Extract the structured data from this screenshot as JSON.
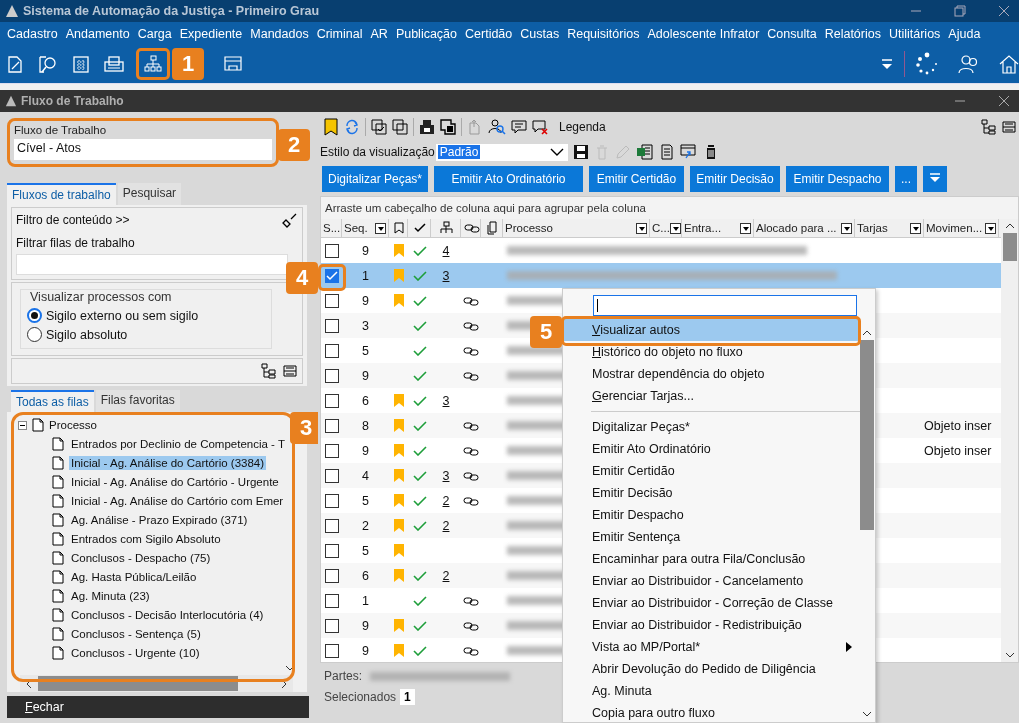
{
  "window": {
    "title": "Sistema de Automação da Justiça - Primeiro Grau"
  },
  "menu": [
    "Cadastro",
    "Andamento",
    "Carga",
    "Expediente",
    "Mandados",
    "Criminal",
    "AR",
    "Publicação",
    "Certidão",
    "Custas",
    "Requisitórios",
    "Adolescente Infrator",
    "Consulta",
    "Relatórios",
    "Utilitários",
    "Ajuda"
  ],
  "subwindow": {
    "title": "Fluxo de Trabalho"
  },
  "callouts": [
    "1",
    "2",
    "3",
    "4",
    "5"
  ],
  "left": {
    "workflow_field": {
      "label": "Fluxo de Trabalho",
      "value": "Cível - Atos"
    },
    "tabs": [
      {
        "label": "Fluxos de trabalho",
        "selected": true
      },
      {
        "label": "Pesquisar",
        "selected": false
      }
    ],
    "filter": {
      "title": "Filtro de conteúdo >>",
      "field_label": "Filtrar filas de trabalho"
    },
    "visibility": {
      "legend": "Visualizar processos com",
      "options": [
        {
          "label": "Sigilo externo ou sem sigilo",
          "selected": true
        },
        {
          "label": "Sigilo absoluto",
          "selected": false
        }
      ]
    },
    "queue_tabs": [
      {
        "label": "Todas as filas",
        "selected": true
      },
      {
        "label": "Filas favoritas",
        "selected": false
      }
    ],
    "tree": {
      "label": "Processo",
      "expanded": true,
      "children": [
        {
          "label": "Entrados por Declinio de Competencia - T",
          "selected": false
        },
        {
          "label": "Inicial - Ag. Análise do Cartório (3384)",
          "selected": true
        },
        {
          "label": "Inicial - Ag. Análise do Cartório - Urgente",
          "selected": false
        },
        {
          "label": "Inicial - Ag. Análise do Cartório com Emer",
          "selected": false
        },
        {
          "label": "Ag. Análise - Prazo Expirado (371)",
          "selected": false
        },
        {
          "label": "Entrados com Sigilo Absoluto",
          "selected": false
        },
        {
          "label": "Conclusos - Despacho (75)",
          "selected": false
        },
        {
          "label": "Ag. Hasta Pública/Leilão",
          "selected": false
        },
        {
          "label": "Ag. Minuta (23)",
          "selected": false
        },
        {
          "label": "Conclusos - Decisão Interlocutória (4)",
          "selected": false
        },
        {
          "label": "Conclusos - Sentença (5)",
          "selected": false
        },
        {
          "label": "Conclusos - Urgente (10)",
          "selected": false
        }
      ]
    },
    "close_button": "Fechar"
  },
  "right": {
    "legend": "Legenda",
    "view_style": {
      "label": "Estilo da visualização",
      "value": "Padrão"
    },
    "action_buttons": [
      "Digitalizar Peças*",
      "Emitir Ato Ordinatório",
      "Emitir Certidão",
      "Emitir Decisão",
      "Emitir Despacho",
      "..."
    ],
    "group_hint": "Arraste um cabeçalho de coluna aqui para agrupar pela coluna",
    "columns": [
      "S...",
      "Seq.",
      "Processo",
      "C...",
      "Entra...",
      "Alocado para ...",
      "Tarjas",
      "Movimen..."
    ],
    "rows": [
      {
        "seq": "9",
        "bookmark": true,
        "done": true,
        "count": "4",
        "linked": false,
        "checked": false,
        "selected": false
      },
      {
        "seq": "1",
        "bookmark": true,
        "done": true,
        "count": "3",
        "linked": false,
        "checked": true,
        "selected": true
      },
      {
        "seq": "9",
        "bookmark": true,
        "done": true,
        "linked": true,
        "checked": false,
        "selected": false
      },
      {
        "seq": "3",
        "bookmark": false,
        "done": true,
        "linked": true,
        "checked": false,
        "selected": false
      },
      {
        "seq": "5",
        "bookmark": false,
        "done": true,
        "linked": true,
        "checked": false,
        "selected": false
      },
      {
        "seq": "9",
        "bookmark": false,
        "done": true,
        "linked": true,
        "checked": false,
        "selected": false
      },
      {
        "seq": "6",
        "bookmark": true,
        "done": true,
        "count": "3",
        "linked": false,
        "checked": false,
        "selected": false
      },
      {
        "seq": "8",
        "bookmark": true,
        "done": true,
        "linked": true,
        "movement": "Objeto inser",
        "checked": false,
        "selected": false
      },
      {
        "seq": "9",
        "bookmark": true,
        "done": true,
        "linked": true,
        "movement": "Objeto inser",
        "checked": false,
        "selected": false
      },
      {
        "seq": "4",
        "bookmark": true,
        "done": true,
        "count": "3",
        "linked": true,
        "checked": false,
        "selected": false
      },
      {
        "seq": "5",
        "bookmark": true,
        "done": true,
        "count": "2",
        "linked": true,
        "checked": false,
        "selected": false
      },
      {
        "seq": "2",
        "bookmark": true,
        "done": true,
        "count": "2",
        "linked": false,
        "checked": false,
        "selected": false
      },
      {
        "seq": "5",
        "bookmark": true,
        "done": false,
        "linked": false,
        "checked": false,
        "selected": false
      },
      {
        "seq": "6",
        "bookmark": true,
        "done": true,
        "count": "2",
        "linked": false,
        "checked": false,
        "selected": false
      },
      {
        "seq": "1",
        "bookmark": false,
        "done": true,
        "linked": true,
        "checked": false,
        "selected": false
      },
      {
        "seq": "9",
        "bookmark": true,
        "done": true,
        "linked": true,
        "checked": false,
        "selected": false
      },
      {
        "seq": "9",
        "bookmark": true,
        "done": true,
        "linked": true,
        "checked": false,
        "selected": false
      }
    ],
    "footer": {
      "parts_label": "Partes:",
      "selected_label": "Selecionados",
      "selected_count": "1"
    },
    "context_menu": {
      "items": [
        {
          "kind": "item",
          "label": "Visualizar autos",
          "selected": true,
          "access_key": true
        },
        {
          "kind": "item",
          "label": "Histórico do objeto no fluxo",
          "selected": false,
          "access_key": true
        },
        {
          "kind": "item",
          "label": "Mostrar dependência do objeto",
          "selected": false,
          "access_key": false
        },
        {
          "kind": "item",
          "label": "Gerenciar Tarjas...",
          "selected": false,
          "access_key": true
        },
        {
          "kind": "separator"
        },
        {
          "kind": "item",
          "label": "Digitalizar Peças*",
          "selected": false,
          "access_key": false
        },
        {
          "kind": "item",
          "label": "Emitir Ato Ordinatório",
          "selected": false,
          "access_key": false
        },
        {
          "kind": "item",
          "label": "Emitir Certidão",
          "selected": false,
          "access_key": false
        },
        {
          "kind": "item",
          "label": "Emitir Decisão",
          "selected": false,
          "access_key": false
        },
        {
          "kind": "item",
          "label": "Emitir Despacho",
          "selected": false,
          "access_key": false
        },
        {
          "kind": "item",
          "label": "Emitir Sentença",
          "selected": false,
          "access_key": false
        },
        {
          "kind": "item",
          "label": "Encaminhar para outra Fila/Conclusão",
          "selected": false,
          "access_key": false
        },
        {
          "kind": "item",
          "label": "Enviar ao Distribuidor - Cancelamento",
          "selected": false,
          "access_key": false
        },
        {
          "kind": "item",
          "label": "Enviar ao Distribuidor - Correção de Classe",
          "selected": false,
          "access_key": false
        },
        {
          "kind": "item",
          "label": "Enviar ao Distribuidor - Redistribuição",
          "selected": false,
          "access_key": false
        },
        {
          "kind": "submenu",
          "label": "Vista ao MP/Portal*",
          "selected": false,
          "access_key": false
        },
        {
          "kind": "item",
          "label": "Abrir Devolução do Pedido de Diligência",
          "selected": false,
          "access_key": false
        },
        {
          "kind": "item",
          "label": "Ag. Minuta",
          "selected": false,
          "access_key": false
        },
        {
          "kind": "item",
          "label": "Copia para outro fluxo",
          "selected": false,
          "access_key": false
        }
      ]
    }
  }
}
